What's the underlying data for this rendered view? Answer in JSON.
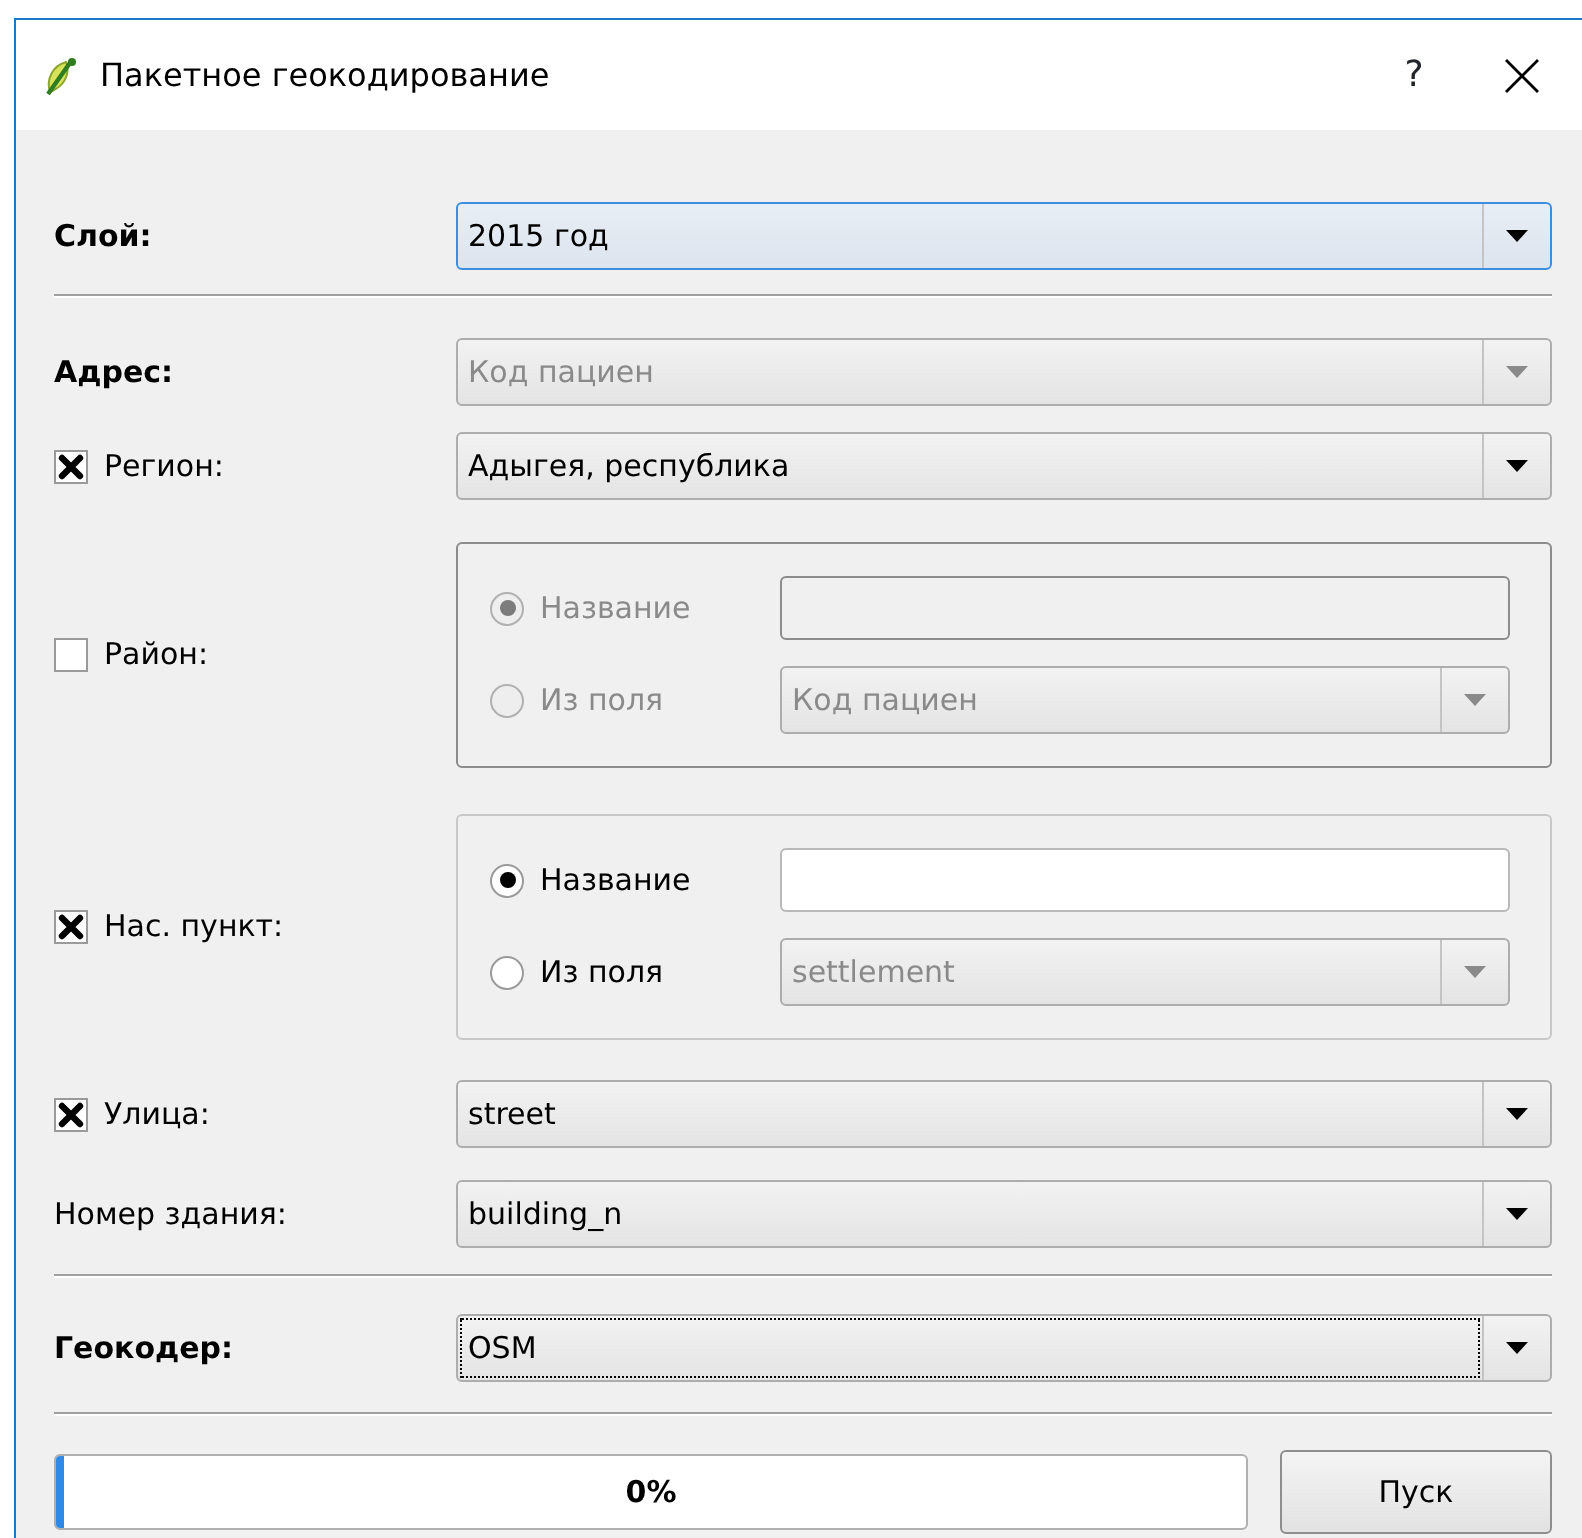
{
  "window": {
    "title": "Пакетное геокодирование",
    "help": "?"
  },
  "fields": [
    {
      "kind": "combo",
      "label": "Слой:",
      "bold": true,
      "value": "2015 год",
      "hovered": true
    },
    {
      "kind": "separator"
    },
    {
      "kind": "combo",
      "label": "Адрес:",
      "bold": true,
      "value": "Код пациен",
      "disabled": true
    },
    {
      "kind": "combo",
      "label": "Регион:",
      "checked": true,
      "value": "Адыгея, республика"
    },
    {
      "kind": "group",
      "label": "Район:",
      "checked": false,
      "disabled": true,
      "options": [
        {
          "label": "Название",
          "selected": true
        },
        {
          "label": "Из поля",
          "selected": false
        }
      ],
      "field_value": "Код пациен"
    },
    {
      "kind": "group",
      "label": "Нас. пункт:",
      "checked": true,
      "disabled": false,
      "options": [
        {
          "label": "Название",
          "selected": true
        },
        {
          "label": "Из поля",
          "selected": false
        }
      ],
      "field_value": "settlement"
    },
    {
      "kind": "combo",
      "label": "Улица:",
      "checked": true,
      "value": "street"
    },
    {
      "kind": "combo",
      "label": "Номер здания:",
      "value": "building_n"
    },
    {
      "kind": "separator"
    },
    {
      "kind": "combo",
      "label": "Геокодер:",
      "bold": true,
      "value": "OSM",
      "focused": true
    },
    {
      "kind": "separator"
    }
  ],
  "progress": {
    "level": 0.006,
    "reading": "0%"
  },
  "run_button": "Пуск"
}
